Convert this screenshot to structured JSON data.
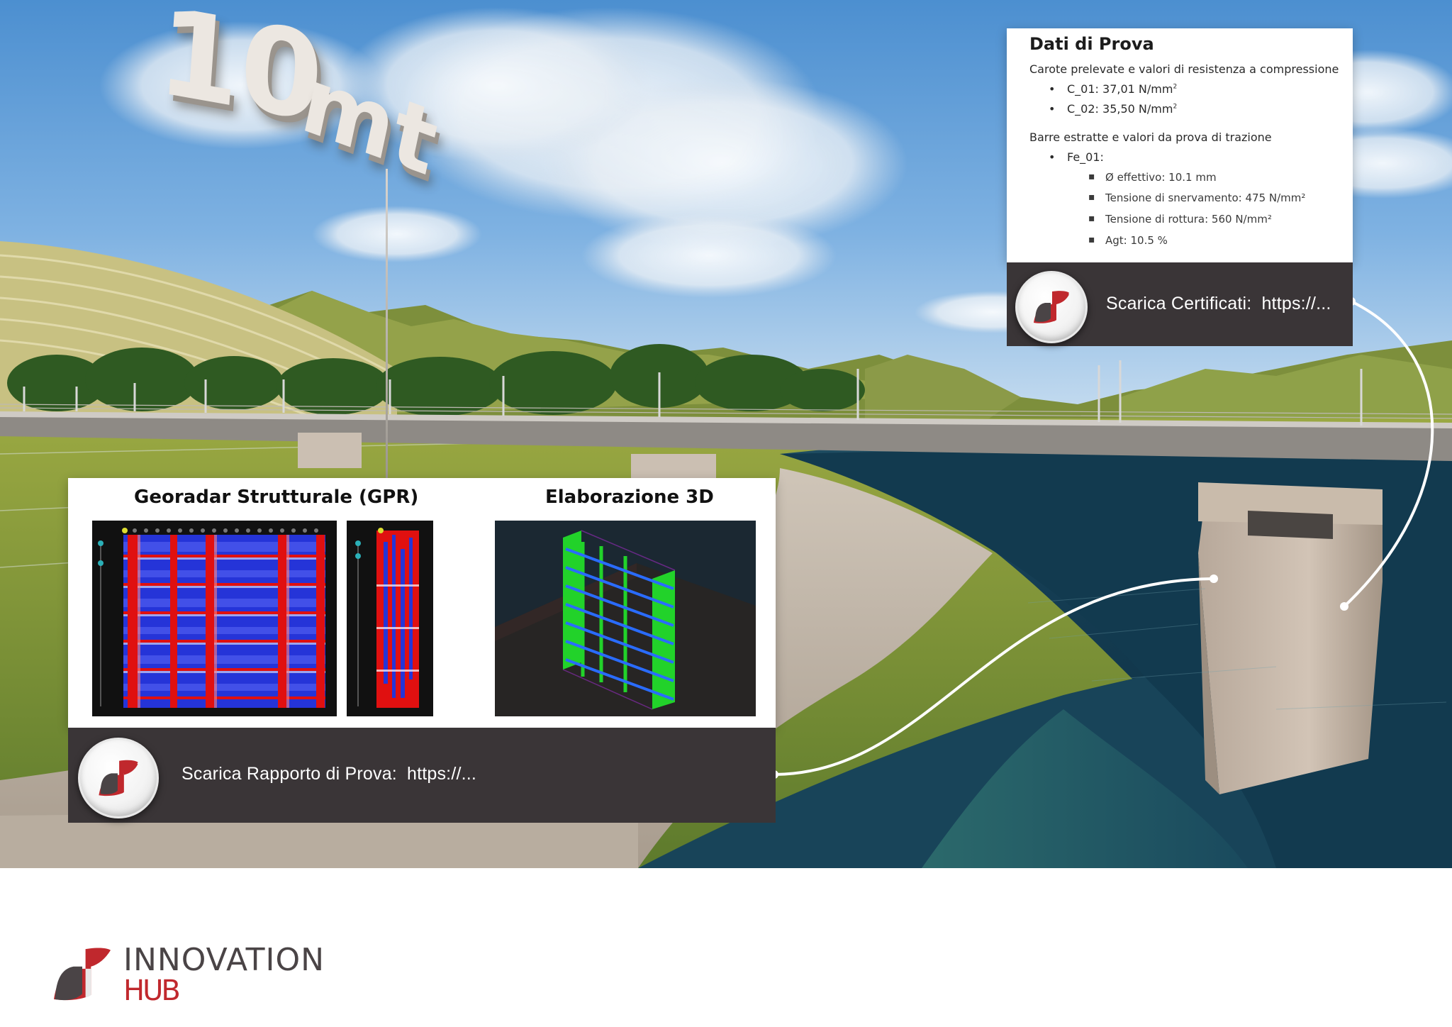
{
  "scene": {
    "sign": {
      "number": "10",
      "unit": "mt"
    }
  },
  "dati_prova": {
    "title": "Dati di Prova",
    "carote_heading": "Carote prelevate e valori di resistenza a compressione",
    "carote": [
      {
        "label": "C_01: 37,01 N/mm",
        "exp": "2"
      },
      {
        "label": "C_02: 35,50 N/mm",
        "exp": "2"
      }
    ],
    "barre_heading": "Barre estratte e valori da prova di trazione",
    "barra": "Fe_01:",
    "barra_values": [
      "Ø effettivo: 10.1 mm",
      "Tensione di snervamento: 475 N/mm²",
      "Tensione di rottura: 560 N/mm²",
      "Agt: 10.5 %"
    ],
    "link_label": "Scarica Certificati:",
    "link_url": "https://..."
  },
  "gpr_panel": {
    "gpr_title": "Georadar Strutturale (GPR)",
    "model_title": "Elaborazione 3D",
    "link_label": "Scarica Rapporto di Prova:",
    "link_url": "https://..."
  },
  "brand": {
    "line1": "INNOVATION",
    "line2": "HUB"
  },
  "colors": {
    "accent_red": "#c0282d",
    "panel_dark": "#3a3537",
    "logo_gray": "#4a4446",
    "gpr_blue": "#1f2fd6",
    "gpr_red": "#e01010",
    "rebar_green": "#22d22a"
  }
}
